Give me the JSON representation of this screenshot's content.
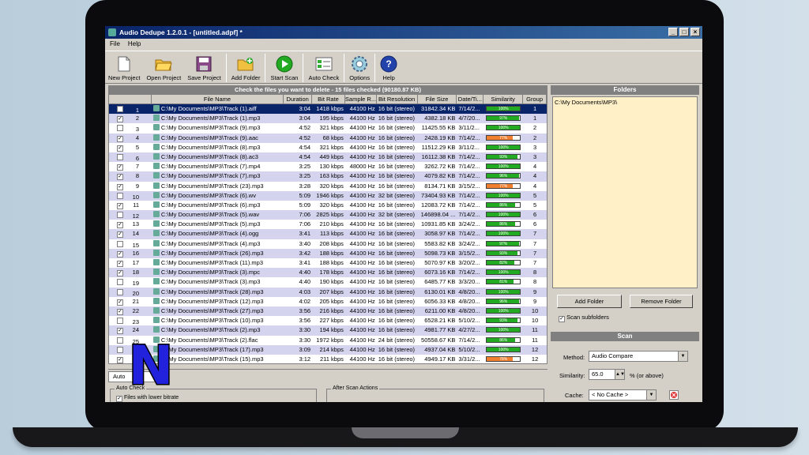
{
  "window": {
    "title": "Audio Dedupe 1.2.0.1 - [untitled.adpf] *"
  },
  "menu": [
    "File",
    "Help"
  ],
  "toolbar": [
    {
      "label": "New Project",
      "icon": "new-project-icon"
    },
    {
      "label": "Open Project",
      "icon": "open-folder-icon"
    },
    {
      "label": "Save Project",
      "icon": "save-icon"
    },
    {
      "label": "Add Folder",
      "icon": "add-folder-icon"
    },
    {
      "label": "Start Scan",
      "icon": "play-icon"
    },
    {
      "label": "Auto Check",
      "icon": "auto-check-icon"
    },
    {
      "label": "Options",
      "icon": "options-icon"
    },
    {
      "label": "Help",
      "icon": "help-icon"
    }
  ],
  "results": {
    "header": "Check the files you want to delete - 15 files checked (90180.87 KB)",
    "columns": [
      "File Name",
      "Duration",
      "Bit Rate",
      "Sample R...",
      "Bit Resolution",
      "File Size",
      "Date/Ti...",
      "Similarity",
      "Group"
    ],
    "rows": [
      {
        "n": "1",
        "checked": false,
        "file": "C:\\My Documents\\MP3\\Track (1).aiff",
        "dur": "3:04",
        "br": "1418 kbps",
        "sr": "44100 Hz",
        "res": "16 bit (stereo)",
        "size": "31842.34 KB",
        "date": "7/14/2...",
        "sim": "100%",
        "pct": 100,
        "group": "1"
      },
      {
        "n": "2",
        "checked": true,
        "file": "C:\\My Documents\\MP3\\Track (1).mp3",
        "dur": "3:04",
        "br": "195 kbps",
        "sr": "44100 Hz",
        "res": "16 bit (stereo)",
        "size": "4382.18 KB",
        "date": "4/7/20...",
        "sim": "97%",
        "pct": 97,
        "group": "1"
      },
      {
        "n": "3",
        "checked": false,
        "file": "C:\\My Documents\\MP3\\Track (9).mp3",
        "dur": "4:52",
        "br": "321 kbps",
        "sr": "44100 Hz",
        "res": "16 bit (stereo)",
        "size": "11425.55 KB",
        "date": "3/11/2...",
        "sim": "100%",
        "pct": 100,
        "group": "2"
      },
      {
        "n": "4",
        "checked": true,
        "file": "C:\\My Documents\\MP3\\Track (9).aac",
        "dur": "4:52",
        "br": "68 kbps",
        "sr": "44100 Hz",
        "res": "16 bit (stereo)",
        "size": "2428.19 KB",
        "date": "7/14/2...",
        "sim": "77%",
        "pct": 77,
        "group": "2"
      },
      {
        "n": "5",
        "checked": true,
        "file": "C:\\My Documents\\MP3\\Track (8).mp3",
        "dur": "4:54",
        "br": "321 kbps",
        "sr": "44100 Hz",
        "res": "16 bit (stereo)",
        "size": "11512.29 KB",
        "date": "3/11/2...",
        "sim": "100%",
        "pct": 100,
        "group": "3"
      },
      {
        "n": "6",
        "checked": false,
        "file": "C:\\My Documents\\MP3\\Track (8).ac3",
        "dur": "4:54",
        "br": "449 kbps",
        "sr": "44100 Hz",
        "res": "16 bit (stereo)",
        "size": "16112.38 KB",
        "date": "7/14/2...",
        "sim": "93%",
        "pct": 93,
        "group": "3"
      },
      {
        "n": "7",
        "checked": true,
        "file": "C:\\My Documents\\MP3\\Track (7).mp4",
        "dur": "3:25",
        "br": "130 kbps",
        "sr": "48000 Hz",
        "res": "16 bit (stereo)",
        "size": "3262.72 KB",
        "date": "7/14/2...",
        "sim": "100%",
        "pct": 100,
        "group": "4"
      },
      {
        "n": "8",
        "checked": true,
        "file": "C:\\My Documents\\MP3\\Track (7).mp3",
        "dur": "3:25",
        "br": "163 kbps",
        "sr": "44100 Hz",
        "res": "16 bit (stereo)",
        "size": "4079.82 KB",
        "date": "7/14/2...",
        "sim": "96%",
        "pct": 96,
        "group": "4"
      },
      {
        "n": "9",
        "checked": true,
        "file": "C:\\My Documents\\MP3\\Track (23).mp3",
        "dur": "3:28",
        "br": "320 kbps",
        "sr": "44100 Hz",
        "res": "16 bit (stereo)",
        "size": "8134.71 KB",
        "date": "3/15/2...",
        "sim": "77%",
        "pct": 77,
        "group": "4"
      },
      {
        "n": "10",
        "checked": false,
        "file": "C:\\My Documents\\MP3\\Track (6).wv",
        "dur": "5:09",
        "br": "1946 kbps",
        "sr": "44100 Hz",
        "res": "32 bit (stereo)",
        "size": "73404.93 KB",
        "date": "7/14/2...",
        "sim": "100%",
        "pct": 100,
        "group": "5"
      },
      {
        "n": "11",
        "checked": true,
        "file": "C:\\My Documents\\MP3\\Track (6).mp3",
        "dur": "5:09",
        "br": "320 kbps",
        "sr": "44100 Hz",
        "res": "16 bit (stereo)",
        "size": "12083.72 KB",
        "date": "7/14/2...",
        "sim": "86%",
        "pct": 86,
        "group": "5"
      },
      {
        "n": "12",
        "checked": false,
        "file": "C:\\My Documents\\MP3\\Track (5).wav",
        "dur": "7:06",
        "br": "2825 kbps",
        "sr": "44100 Hz",
        "res": "32 bit (stereo)",
        "size": "146898.04 ...",
        "date": "7/14/2...",
        "sim": "100%",
        "pct": 100,
        "group": "6"
      },
      {
        "n": "13",
        "checked": true,
        "file": "C:\\My Documents\\MP3\\Track (5).mp3",
        "dur": "7:06",
        "br": "210 kbps",
        "sr": "44100 Hz",
        "res": "16 bit (stereo)",
        "size": "10931.85 KB",
        "date": "3/24/2...",
        "sim": "86%",
        "pct": 86,
        "group": "6"
      },
      {
        "n": "14",
        "checked": true,
        "file": "C:\\My Documents\\MP3\\Track (4).ogg",
        "dur": "3:41",
        "br": "113 kbps",
        "sr": "44100 Hz",
        "res": "16 bit (stereo)",
        "size": "3058.97 KB",
        "date": "7/14/2...",
        "sim": "100%",
        "pct": 100,
        "group": "7"
      },
      {
        "n": "15",
        "checked": false,
        "file": "C:\\My Documents\\MP3\\Track (4).mp3",
        "dur": "3:40",
        "br": "208 kbps",
        "sr": "44100 Hz",
        "res": "16 bit (stereo)",
        "size": "5583.82 KB",
        "date": "3/24/2...",
        "sim": "97%",
        "pct": 97,
        "group": "7"
      },
      {
        "n": "16",
        "checked": true,
        "file": "C:\\My Documents\\MP3\\Track (26).mp3",
        "dur": "3:42",
        "br": "188 kbps",
        "sr": "44100 Hz",
        "res": "16 bit (stereo)",
        "size": "5098.73 KB",
        "date": "3/15/2...",
        "sim": "93%",
        "pct": 93,
        "group": "7"
      },
      {
        "n": "17",
        "checked": true,
        "file": "C:\\My Documents\\MP3\\Track (11).mp3",
        "dur": "3:41",
        "br": "188 kbps",
        "sr": "44100 Hz",
        "res": "16 bit (stereo)",
        "size": "5070.97 KB",
        "date": "3/20/2...",
        "sim": "82%",
        "pct": 82,
        "group": "7"
      },
      {
        "n": "18",
        "checked": true,
        "file": "C:\\My Documents\\MP3\\Track (3).mpc",
        "dur": "4:40",
        "br": "178 kbps",
        "sr": "44100 Hz",
        "res": "16 bit (stereo)",
        "size": "6073.16 KB",
        "date": "7/14/2...",
        "sim": "100%",
        "pct": 100,
        "group": "8"
      },
      {
        "n": "19",
        "checked": false,
        "file": "C:\\My Documents\\MP3\\Track (3).mp3",
        "dur": "4:40",
        "br": "190 kbps",
        "sr": "44100 Hz",
        "res": "16 bit (stereo)",
        "size": "6485.77 KB",
        "date": "3/3/20...",
        "sim": "81%",
        "pct": 81,
        "group": "8"
      },
      {
        "n": "20",
        "checked": false,
        "file": "C:\\My Documents\\MP3\\Track (28).mp3",
        "dur": "4:03",
        "br": "207 kbps",
        "sr": "44100 Hz",
        "res": "16 bit (stereo)",
        "size": "6130.01 KB",
        "date": "4/8/20...",
        "sim": "100%",
        "pct": 100,
        "group": "9"
      },
      {
        "n": "21",
        "checked": true,
        "file": "C:\\My Documents\\MP3\\Track (12).mp3",
        "dur": "4:02",
        "br": "205 kbps",
        "sr": "44100 Hz",
        "res": "16 bit (stereo)",
        "size": "6056.33 KB",
        "date": "4/8/20...",
        "sim": "96%",
        "pct": 96,
        "group": "9"
      },
      {
        "n": "22",
        "checked": true,
        "file": "C:\\My Documents\\MP3\\Track (27).mp3",
        "dur": "3:56",
        "br": "216 kbps",
        "sr": "44100 Hz",
        "res": "16 bit (stereo)",
        "size": "6211.00 KB",
        "date": "4/8/20...",
        "sim": "100%",
        "pct": 100,
        "group": "10"
      },
      {
        "n": "23",
        "checked": false,
        "file": "C:\\My Documents\\MP3\\Track (10).mp3",
        "dur": "3:56",
        "br": "227 kbps",
        "sr": "44100 Hz",
        "res": "16 bit (stereo)",
        "size": "6528.21 KB",
        "date": "5/10/2...",
        "sim": "93%",
        "pct": 93,
        "group": "10"
      },
      {
        "n": "24",
        "checked": true,
        "file": "C:\\My Documents\\MP3\\Track (2).mp3",
        "dur": "3:30",
        "br": "194 kbps",
        "sr": "44100 Hz",
        "res": "16 bit (stereo)",
        "size": "4981.77 KB",
        "date": "4/27/2...",
        "sim": "100%",
        "pct": 100,
        "group": "11"
      },
      {
        "n": "25",
        "checked": false,
        "file": "C:\\My Documents\\MP3\\Track (2).flac",
        "dur": "3:30",
        "br": "1972 kbps",
        "sr": "44100 Hz",
        "res": "24 bit (stereo)",
        "size": "50558.67 KB",
        "date": "7/14/2...",
        "sim": "86%",
        "pct": 86,
        "group": "11"
      },
      {
        "n": "26",
        "checked": false,
        "file": "C:\\My Documents\\MP3\\Track (17).mp3",
        "dur": "3:09",
        "br": "214 kbps",
        "sr": "44100 Hz",
        "res": "16 bit (stereo)",
        "size": "4937.04 KB",
        "date": "5/10/2...",
        "sim": "100%",
        "pct": 100,
        "group": "12"
      },
      {
        "n": "27",
        "checked": true,
        "file": "C:\\My Documents\\MP3\\Track (15).mp3",
        "dur": "3:12",
        "br": "211 kbps",
        "sr": "44100 Hz",
        "res": "16 bit (stereo)",
        "size": "4949.17 KB",
        "date": "3/31/2...",
        "sim": "78%",
        "pct": 78,
        "group": "12"
      }
    ]
  },
  "bottom": {
    "tab_label": "Auto",
    "auto_check_label": "Auto Check",
    "files_lower_bitrate": "Files with lower bitrate",
    "after_scan_label": "After Scan Actions"
  },
  "folders": {
    "header": "Folders",
    "items": [
      "C:\\My Documents\\MP3\\"
    ],
    "add_button": "Add Folder",
    "remove_button": "Remove Folder",
    "scan_subfolders": "Scan subfolders"
  },
  "scan": {
    "header": "Scan",
    "method_label": "Method:",
    "method_value": "Audio Compare",
    "similarity_label": "Similarity:",
    "similarity_value": "65.0",
    "similarity_suffix": "% (or above)",
    "cache_label": "Cache:",
    "cache_value": "< No Cache >"
  },
  "logo": {
    "letter": "N"
  },
  "colors": {
    "title_bar": "#0a246a",
    "selected_row": "#0a246a",
    "alt_row": "#d4d4ee",
    "sim_green": "#22aa22",
    "sim_orange": "#f08030",
    "logo_fill": "#2222dd"
  }
}
